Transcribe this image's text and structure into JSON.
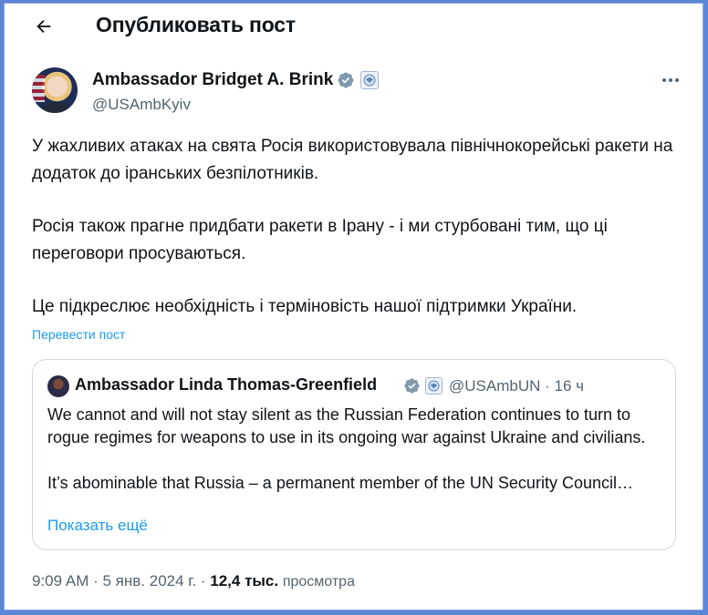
{
  "header": {
    "title": "Опубликовать пост"
  },
  "post": {
    "author_name": "Ambassador Bridget A. Brink",
    "author_handle": "@USAmbKyiv",
    "paragraphs": [
      "У жахливих атаках на свята Росія використовувала північнокорейські ракети на додаток до іранських безпілотників.",
      "Росія також прагне придбати ракети в Ірану - і ми стурбовані тим, що ці переговори просуваються.",
      "Це підкреслює необхідність і терміновість нашої підтримки України."
    ],
    "translate_label": "Перевести пост",
    "time": "9:09 AM",
    "date": "5 янв. 2024 г.",
    "views_count": "12,4 тыс.",
    "views_label": "просмотра"
  },
  "quote": {
    "author_name": "Ambassador Linda Thomas-Greenfield",
    "author_handle": "@USAmbUN",
    "age": "16 ч",
    "paragraphs": [
      "We cannot and will not stay silent as the Russian Federation continues to turn to rogue regimes for weapons to use in its ongoing war against Ukraine and civilians.",
      "It’s abominable that Russia – a permanent member of the UN Security Council…"
    ],
    "show_more_label": "Показать ещё"
  },
  "icons": {
    "back": "arrow-left-icon",
    "verified": "verified-badge-icon",
    "government": "government-seal-icon",
    "more": "more-options-icon"
  },
  "colors": {
    "accent": "#1d9bf0",
    "secondary_text": "#536471",
    "verified_badge": "#829aab",
    "border": "#cfd9de"
  }
}
